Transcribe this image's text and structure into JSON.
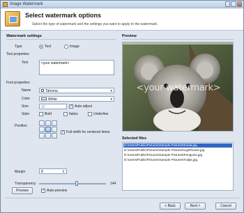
{
  "window": {
    "title": "Image Watermark"
  },
  "header": {
    "title": "Select watermark options",
    "subtitle": "Select the type of watermark and the settings you want to apply to the watermark."
  },
  "settings": {
    "section_title": "Watermark settings",
    "type_label": "Type",
    "type_options": [
      "Text",
      "Image"
    ],
    "type_selected": "Text",
    "text_properties_label": "Text properties",
    "text_label": "Text",
    "text_value": "<your watermark>",
    "font_properties_label": "Font properties",
    "name_label": "Name",
    "name_value": "Tahoma",
    "color_label": "Color",
    "color_value": "White",
    "size_label": "Size",
    "size_value": "22",
    "auto_adjust_label": "Auto adjust",
    "style_label": "Style",
    "bold_label": "Bold",
    "italics_label": "Italics",
    "underline_label": "Underline",
    "position_label": "Position",
    "full_width_label": "Full width for centered items",
    "margin_label": "Margin",
    "margin_value": "8",
    "transparency_label": "Transparency",
    "transparency_value": "144",
    "transparency_fraction": 0.56
  },
  "preview": {
    "section_title": "Preview",
    "watermark_text": "<your watermark>"
  },
  "files": {
    "section_title": "Selected files",
    "items": [
      "D:\\Users\\Public\\Pictures\\Sample Pictures\\Koala.jpg",
      "D:\\Users\\Public\\Pictures\\Sample Pictures\\Lighthouse.jpg",
      "D:\\Users\\Public\\Pictures\\Sample Pictures\\Penguins.jpg",
      "D:\\Users\\Public\\Pictures\\Sample Pictures\\Tulips.jpg"
    ]
  },
  "actions": {
    "preview_button": "Preview",
    "auto_preview_label": "Auto-preview",
    "back_button": "< Back",
    "next_button": "Next >",
    "cancel_button": "Cancel"
  },
  "colors": {
    "accent": "#3367c4",
    "window_bg": "#dfe6ef",
    "selection": "#3367c4"
  }
}
